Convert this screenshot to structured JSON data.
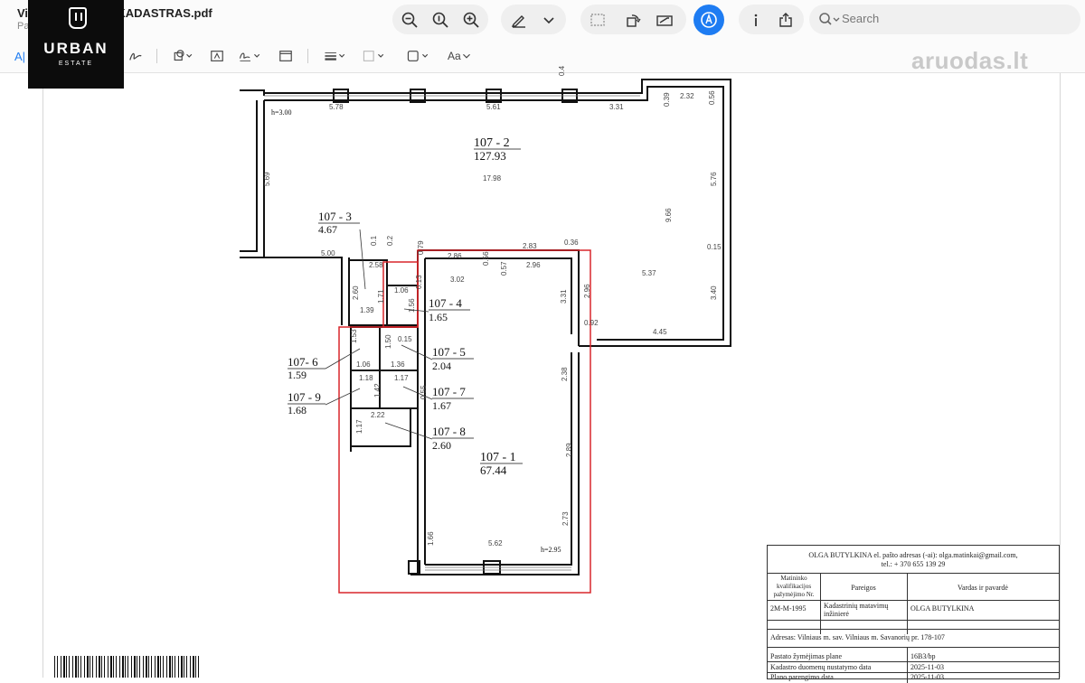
{
  "window": {
    "title": "Vi              rių pr. 178-107_KADASTRAS.pdf",
    "subtitle": "Pa"
  },
  "logo": {
    "word": "URBAN",
    "sub": "ESTATE"
  },
  "search": {
    "placeholder": "Search"
  },
  "toolbar2": {
    "text_tool": "A|",
    "font_menu": "Aa"
  },
  "watermark": {
    "text": "aruodas.lt"
  },
  "plan": {
    "rooms": [
      {
        "id": "107 - 2",
        "area": "127.93"
      },
      {
        "id": "107 - 3",
        "area": "4.67"
      },
      {
        "id": "107 - 4",
        "area": "1.65"
      },
      {
        "id": "107 - 5",
        "area": "2.04"
      },
      {
        "id": "107- 6",
        "area": "1.59"
      },
      {
        "id": "107 - 7",
        "area": "1.67"
      },
      {
        "id": "107 - 9",
        "area": "1.68"
      },
      {
        "id": "107 - 8",
        "area": "2.60"
      },
      {
        "id": "107 - 1",
        "area": "67.44"
      }
    ],
    "heights": [
      "h=3.00",
      "h=2.95"
    ],
    "dimensions": [
      "5.78",
      "5.61",
      "3.31",
      "0.39",
      "2.32",
      "0.56",
      "5.69",
      "17.98",
      "5.76",
      "9.66",
      "0.15",
      "5.37",
      "3.40",
      "4.45",
      "5.00",
      "2.86",
      "0.56",
      "2.83",
      "0.36",
      "3.02",
      "0.57",
      "2.96",
      "3.31",
      "2.96",
      "0.92",
      "2.58",
      "1.06",
      "1.39",
      "2.60",
      "1.56",
      "1.71",
      "0.13",
      "0.15",
      "1.50",
      "1.06",
      "1.36",
      "1.18",
      "1.42",
      "1.17",
      "0.55",
      "2.38",
      "2.22",
      "1.17",
      "2.89",
      "2.73",
      "1.66",
      "5.62",
      "0.4",
      "0.1",
      "0.2",
      "0.79",
      "1.53"
    ]
  },
  "title_block": {
    "author_line": "OLGA BUTYLKINA el. pašto adresas (-ai): olga.matinkai@gmail.com,",
    "phone_line": "tel.: + 370 655 139 29",
    "col1_header": "Matininko kvalifikacijos pažymėjimo Nr.",
    "col2_header": "Pareigos",
    "col3_header": "Vardas ir pavardė",
    "cert_no": "2M-M-1995",
    "position": "Kadastrinių matavimų inžinierė",
    "name": "OLGA BUTYLKINA",
    "address": "Adresas: Vilniaus m. sav. Vilniaus m. Savanorių pr. 178-107",
    "row1_label": "Pastato žymėjimas plane",
    "row1_value": "16B3/bp",
    "row2_label": "Kadastro duomenų nustatymo data",
    "row2_value": "2025-11-03",
    "row3_label": "Plano parengimo data",
    "row3_value": "2025-11-03"
  },
  "colors": {
    "accent": "#1e7cf2",
    "highlight": "#d9262b"
  }
}
